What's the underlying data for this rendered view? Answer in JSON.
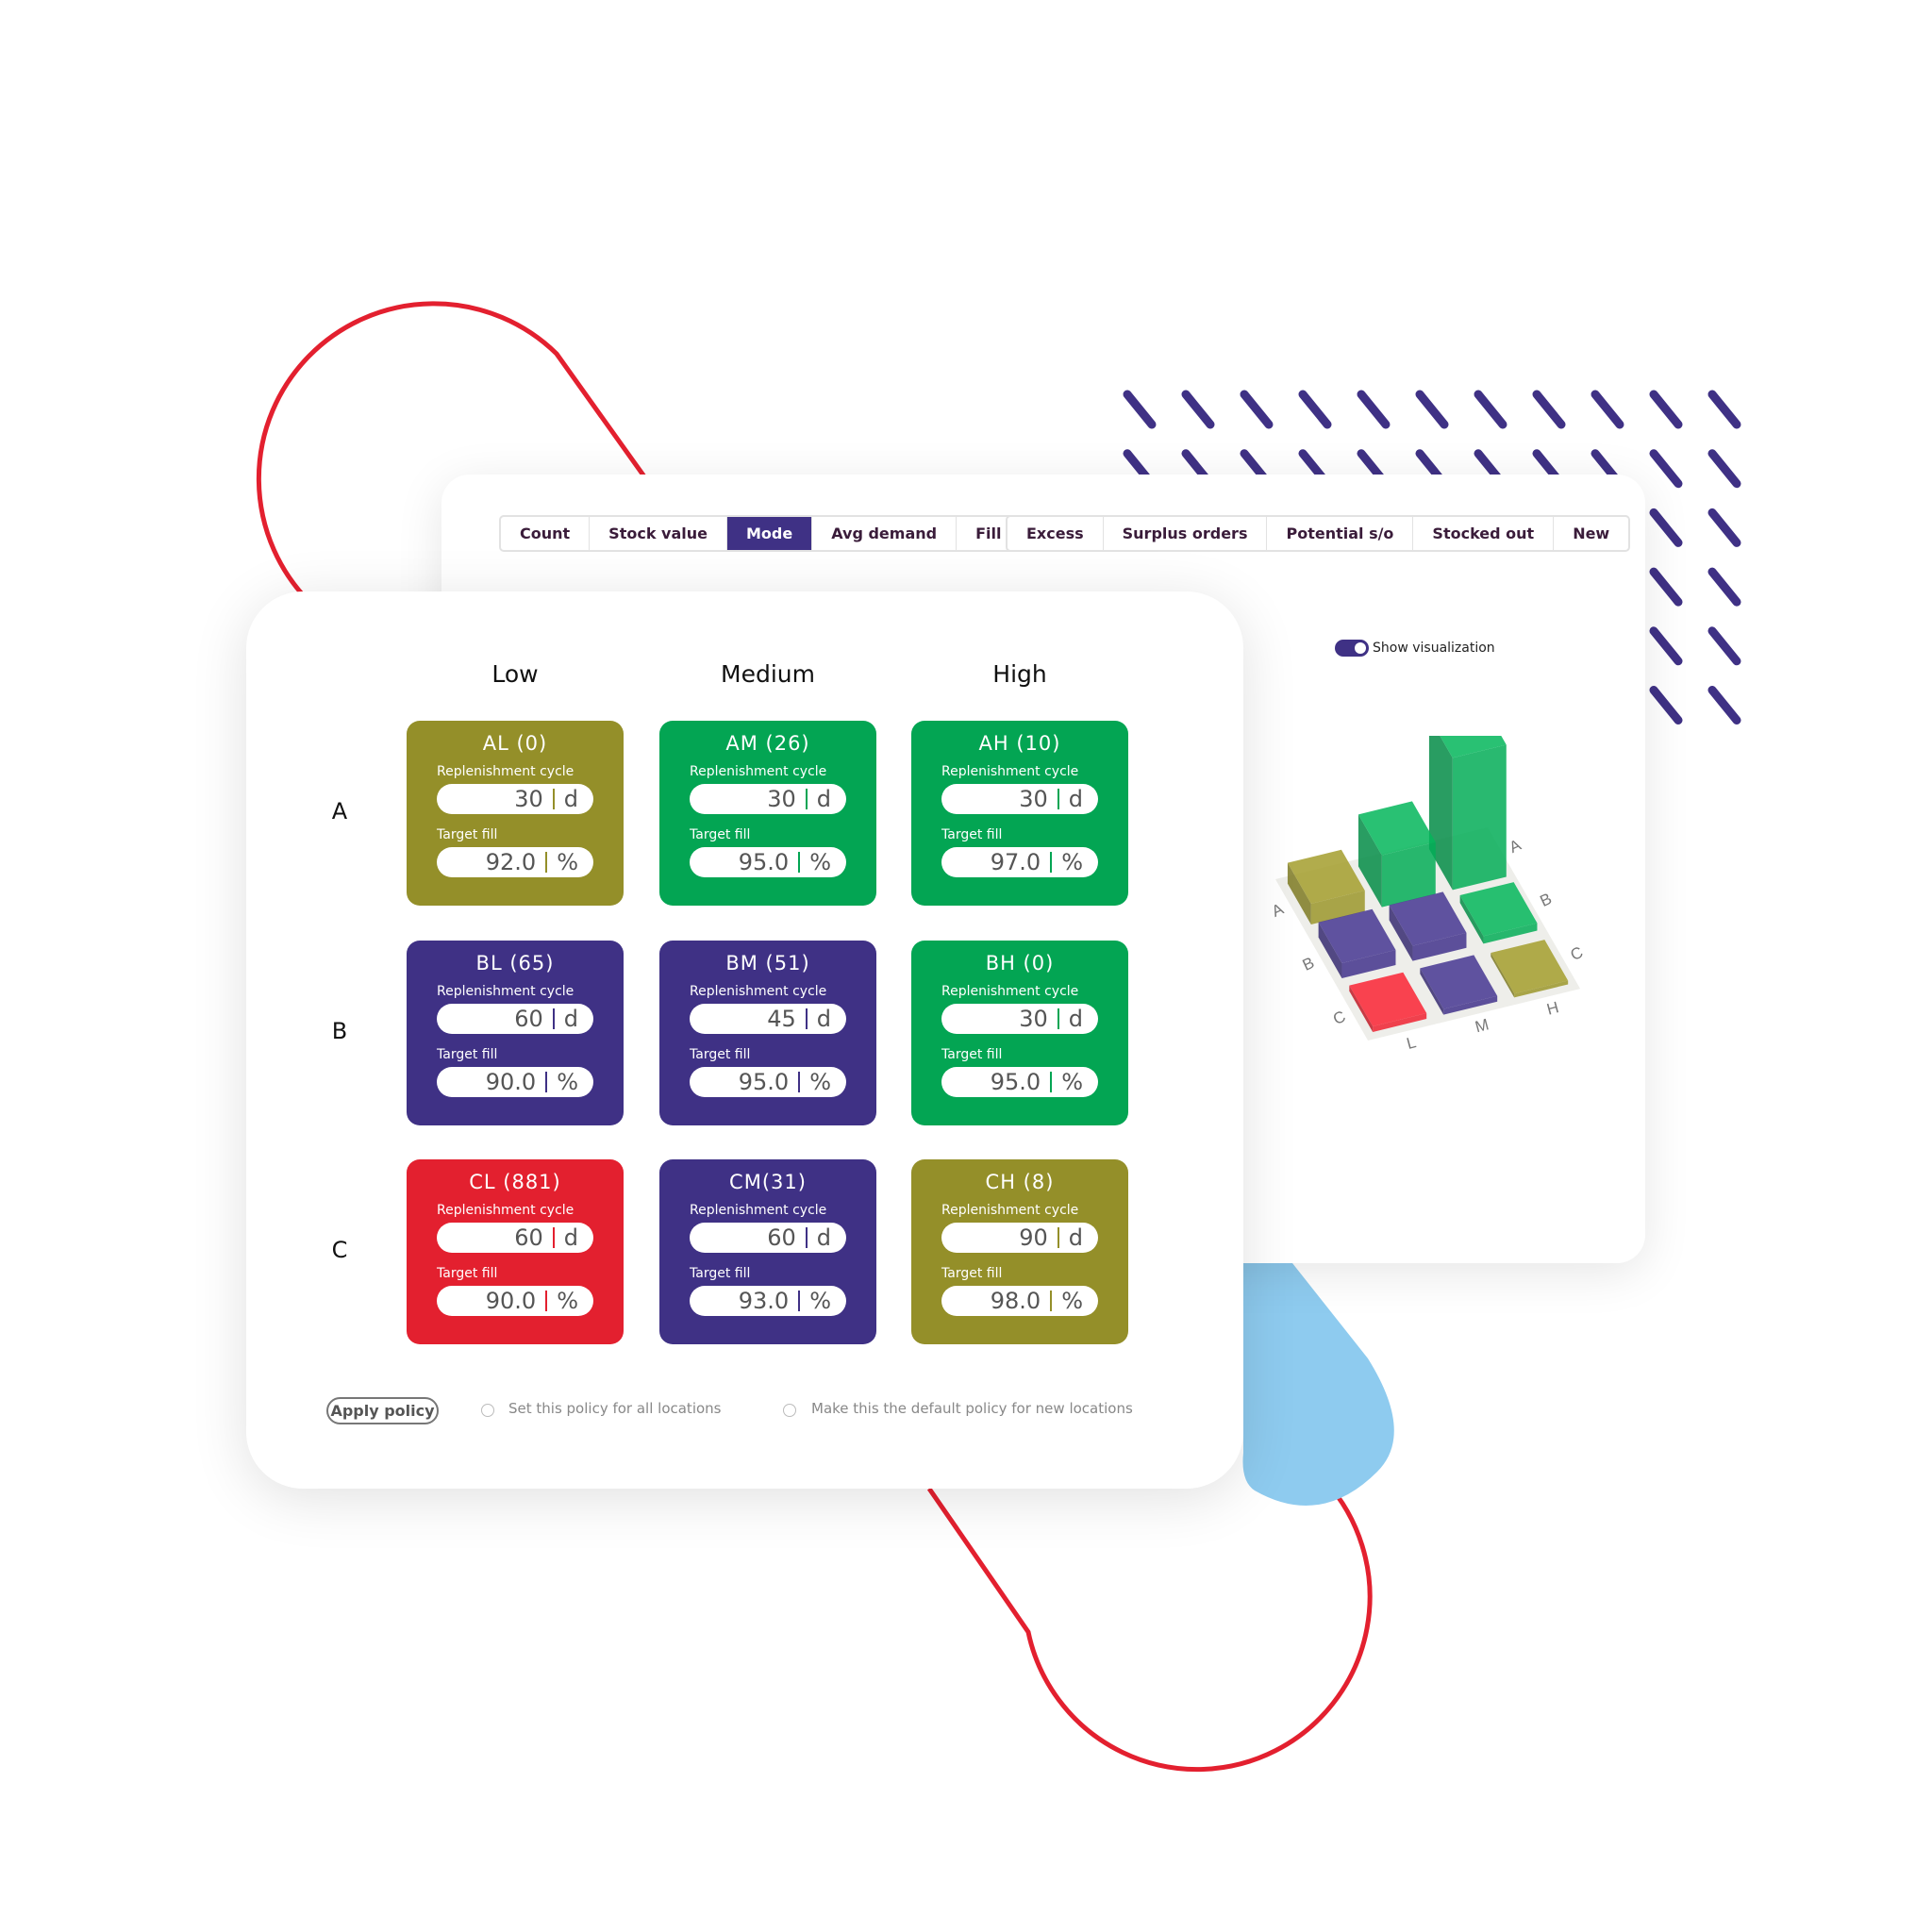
{
  "tabs_group_1": [
    {
      "label": "Count"
    },
    {
      "label": "Stock value"
    },
    {
      "label": "Mode",
      "active": true
    },
    {
      "label": "Avg demand"
    },
    {
      "label": "Fill"
    }
  ],
  "tabs_group_2": [
    {
      "label": "Excess"
    },
    {
      "label": "Surplus orders"
    },
    {
      "label": "Potential s/o"
    },
    {
      "label": "Stocked out"
    },
    {
      "label": "New"
    }
  ],
  "visualization": {
    "toggle_label": "Show visualization",
    "toggle_on": true,
    "row_labels": [
      "A",
      "B",
      "C"
    ],
    "col_labels": [
      "L",
      "M",
      "H"
    ]
  },
  "matrix": {
    "columns": [
      "Low",
      "Medium",
      "High"
    ],
    "rows": [
      "A",
      "B",
      "C"
    ],
    "field_labels": {
      "cycle": "Replenishment cycle",
      "fill": "Target fill"
    },
    "units": {
      "cycle": "d",
      "fill": "%"
    },
    "cells": [
      [
        {
          "code": "AL (0)",
          "cycle": "30",
          "fill": "92.0",
          "color": "#948f29"
        },
        {
          "code": "AM (26)",
          "cycle": "30",
          "fill": "95.0",
          "color": "#03a553"
        },
        {
          "code": "AH (10)",
          "cycle": "30",
          "fill": "97.0",
          "color": "#03a553"
        }
      ],
      [
        {
          "code": "BL (65)",
          "cycle": "60",
          "fill": "90.0",
          "color": "#3f3185"
        },
        {
          "code": "BM (51)",
          "cycle": "45",
          "fill": "95.0",
          "color": "#3f3185"
        },
        {
          "code": "BH (0)",
          "cycle": "30",
          "fill": "95.0",
          "color": "#03a553"
        }
      ],
      [
        {
          "code": "CL (881)",
          "cycle": "60",
          "fill": "90.0",
          "color": "#e3202f"
        },
        {
          "code": "CM(31)",
          "cycle": "60",
          "fill": "93.0",
          "color": "#3f3185"
        },
        {
          "code": "CH (8)",
          "cycle": "90",
          "fill": "98.0",
          "color": "#948f29"
        }
      ]
    ]
  },
  "footer": {
    "apply_label": "Apply policy",
    "option_all": "Set this policy for all locations",
    "option_default": "Make this the default policy for new locations"
  },
  "colors": {
    "accent": "#3f3185",
    "ring": "#e3202f",
    "drop": "#8ecbef"
  }
}
